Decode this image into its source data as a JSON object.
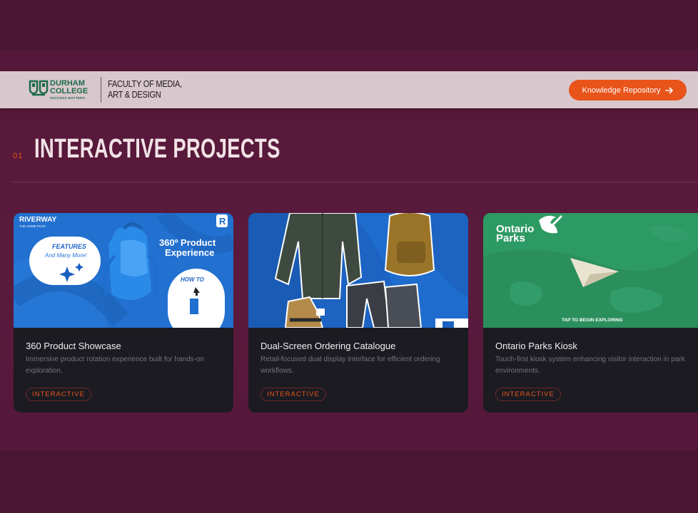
{
  "header": {
    "logo": {
      "name_line1": "DURHAM",
      "name_line2": "COLLEGE",
      "tagline": "SUCCESS MATTERS"
    },
    "faculty_line1": "FACULTY OF MEDIA,",
    "faculty_line2": "ART & DESIGN",
    "cta_label": "Knowledge Repository"
  },
  "section": {
    "number": "01",
    "title": "INTERACTIVE PROJECTS"
  },
  "cards": [
    {
      "title": "360 Product Showcase",
      "description": "Immersive product rotation experience built for hands-on exploration.",
      "tag": "INTERACTIVE",
      "image_text": {
        "brand": "RIVERWAY",
        "brand_sub": "THE HOME PACK",
        "features": "FEATURES",
        "many_more": "And Many More!",
        "headline_1": "360º Product",
        "headline_2": "Experience",
        "how_to": "HOW TO"
      }
    },
    {
      "title": "Dual-Screen Ordering Catalogue",
      "description": "Retail-focused dual display interface for efficient ordering workflows.",
      "tag": "INTERACTIVE"
    },
    {
      "title": "Ontario Parks Kiosk",
      "description": "Touch-first kiosk system enhancing visitor interaction in park environments.",
      "tag": "INTERACTIVE",
      "image_text": {
        "brand_1": "Ontario",
        "brand_2": "Parks",
        "prompt": "TAP TO BEGIN EXPLORING"
      }
    }
  ],
  "colors": {
    "background": "#4b1532",
    "header": "#d8c7cd",
    "accent": "#e8541a",
    "card": "#1c1b22",
    "brand_green": "#1c6b4a"
  },
  "icons": {
    "cta": "arrow-right-icon",
    "logo": "shield-icon"
  }
}
